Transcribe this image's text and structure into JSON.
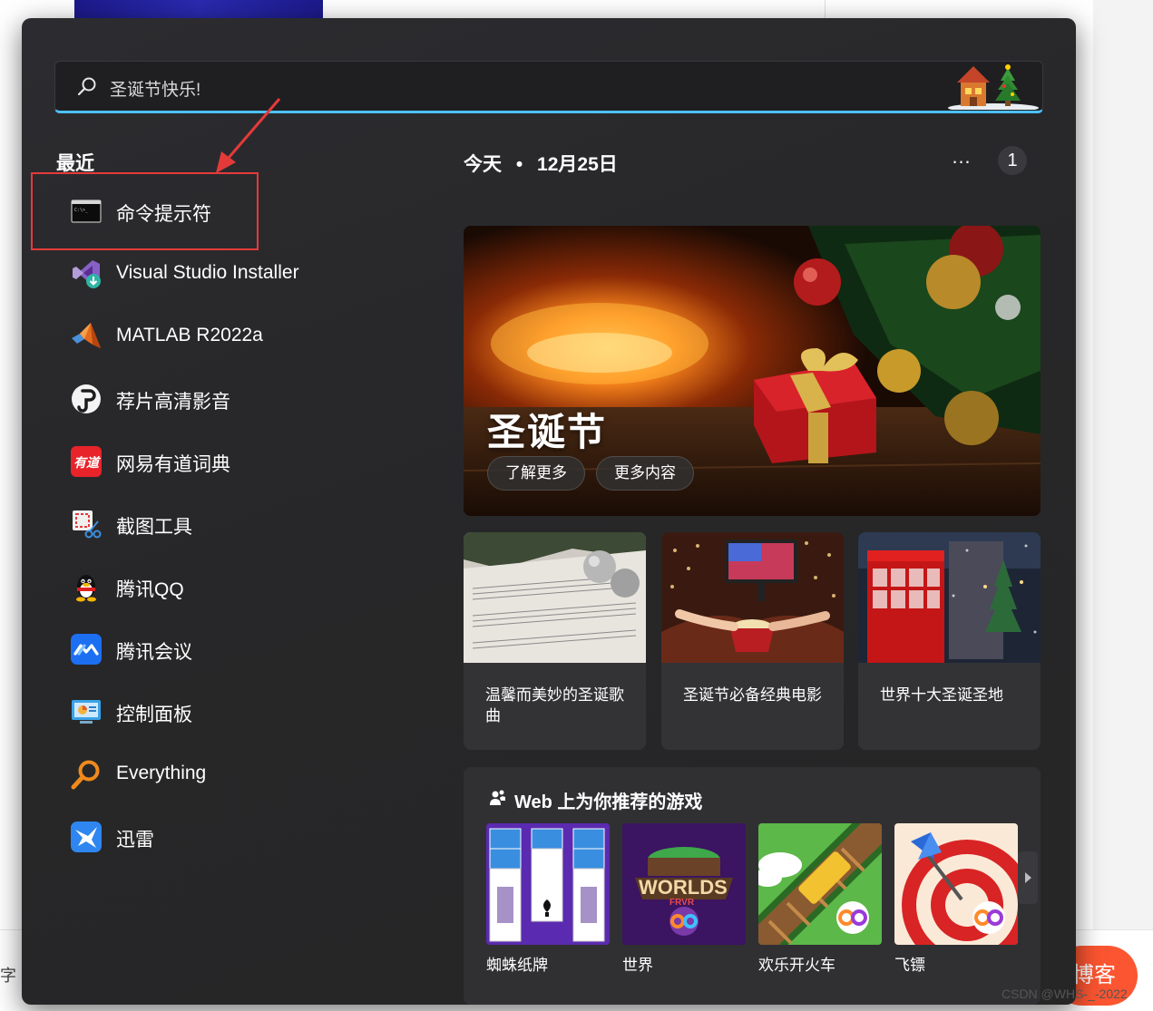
{
  "search": {
    "value": "圣诞节快乐!"
  },
  "recent": {
    "title": "最近",
    "items": [
      {
        "label": "命令提示符",
        "icon": "cmd-icon"
      },
      {
        "label": "Visual Studio Installer",
        "icon": "visual-studio-installer-icon"
      },
      {
        "label": "MATLAB R2022a",
        "icon": "matlab-icon"
      },
      {
        "label": "荐片高清影音",
        "icon": "jianpian-icon"
      },
      {
        "label": "网易有道词典",
        "icon": "youdao-icon"
      },
      {
        "label": "截图工具",
        "icon": "snipping-tool-icon"
      },
      {
        "label": "腾讯QQ",
        "icon": "qq-penguin-icon"
      },
      {
        "label": "腾讯会议",
        "icon": "tencent-meeting-icon"
      },
      {
        "label": "控制面板",
        "icon": "control-panel-icon"
      },
      {
        "label": "Everything",
        "icon": "everything-magnifier-icon"
      },
      {
        "label": "迅雷",
        "icon": "xunlei-bird-icon"
      }
    ],
    "youdao_badge": "有道"
  },
  "today": {
    "label": "今天",
    "separator": "•",
    "date": "12月25日",
    "more": "…",
    "count": "1"
  },
  "hero": {
    "title": "圣诞节",
    "learn_more": "了解更多",
    "more_content": "更多内容"
  },
  "cards": [
    {
      "text": "温馨而美妙的圣诞歌曲"
    },
    {
      "text": "圣诞节必备经典电影"
    },
    {
      "text": "世界十大圣诞圣地"
    }
  ],
  "games": {
    "title": "Web 上为你推荐的游戏",
    "items": [
      {
        "name": "蜘蛛纸牌"
      },
      {
        "name": "世界",
        "logo_text": "WORLDS",
        "logo_sub": "FRVR"
      },
      {
        "name": "欢乐开火车"
      },
      {
        "name": "飞镖"
      }
    ]
  },
  "background": {
    "footer_char": "字",
    "blog_button": "博客",
    "watermark": "CSDN @WHS-_-2022"
  },
  "colors": {
    "accent": "#4cc2ff",
    "highlight": "#e53a3a",
    "panel": "#272729"
  }
}
